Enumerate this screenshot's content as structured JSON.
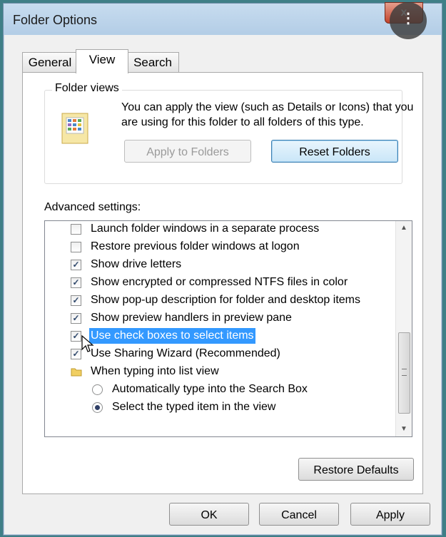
{
  "window": {
    "title": "Folder Options",
    "close_glyph": "x",
    "overlay_glyph": "⋮"
  },
  "tabs": [
    {
      "label": "General"
    },
    {
      "label": "View"
    },
    {
      "label": "Search"
    }
  ],
  "folder_views": {
    "legend": "Folder views",
    "description": "You can apply the view (such as Details or Icons) that you are using for this folder to all folders of this type.",
    "apply_label": "Apply to Folders",
    "reset_label": "Reset Folders"
  },
  "advanced": {
    "label": "Advanced settings:",
    "items": [
      {
        "label": "Launch folder windows in a separate process",
        "checked": false
      },
      {
        "label": "Restore previous folder windows at logon",
        "checked": false
      },
      {
        "label": "Show drive letters",
        "checked": true
      },
      {
        "label": "Show encrypted or compressed NTFS files in color",
        "checked": true
      },
      {
        "label": "Show pop-up description for folder and desktop items",
        "checked": true
      },
      {
        "label": "Show preview handlers in preview pane",
        "checked": true
      },
      {
        "label": "Use check boxes to select items",
        "checked": true,
        "highlighted": true
      },
      {
        "label": "Use Sharing Wizard (Recommended)",
        "checked": true
      },
      {
        "label": "When typing into list view",
        "type": "group"
      },
      {
        "label": "Automatically type into the Search Box",
        "type": "radio",
        "selected": false
      },
      {
        "label": "Select the typed item in the view",
        "type": "radio",
        "selected": true
      }
    ],
    "restore_label": "Restore Defaults"
  },
  "footer": {
    "ok_label": "OK",
    "cancel_label": "Cancel",
    "apply_label": "Apply"
  },
  "glyphs": {
    "check": "✓",
    "scroll_up": "▲",
    "scroll_down": "▼"
  }
}
